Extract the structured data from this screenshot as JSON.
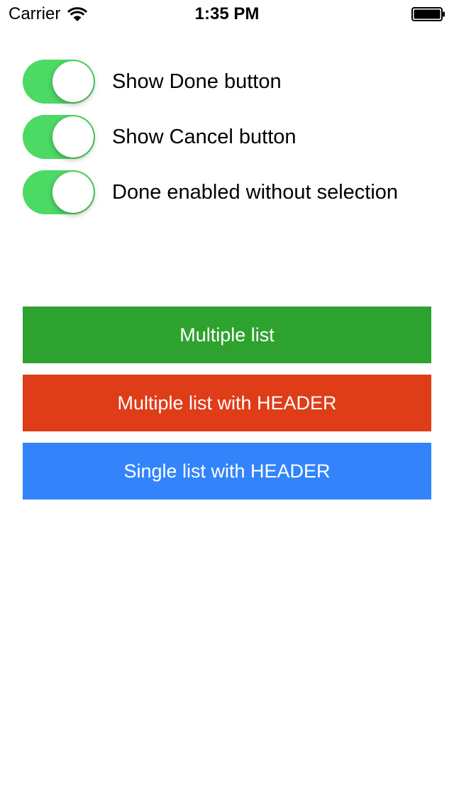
{
  "status_bar": {
    "carrier": "Carrier",
    "time": "1:35 PM",
    "wifi_icon": "wifi-icon",
    "battery_icon": "battery-full-icon"
  },
  "toggles": [
    {
      "label": "Show Done button",
      "on": true
    },
    {
      "label": "Show Cancel button",
      "on": true
    },
    {
      "label": "Done enabled without selection",
      "on": true
    }
  ],
  "toggle_on_color": "#4cd964",
  "buttons": [
    {
      "label": "Multiple list",
      "color": "#2ea22e"
    },
    {
      "label": "Multiple list with HEADER",
      "color": "#df3c18"
    },
    {
      "label": "Single list with HEADER",
      "color": "#3384fb"
    }
  ]
}
